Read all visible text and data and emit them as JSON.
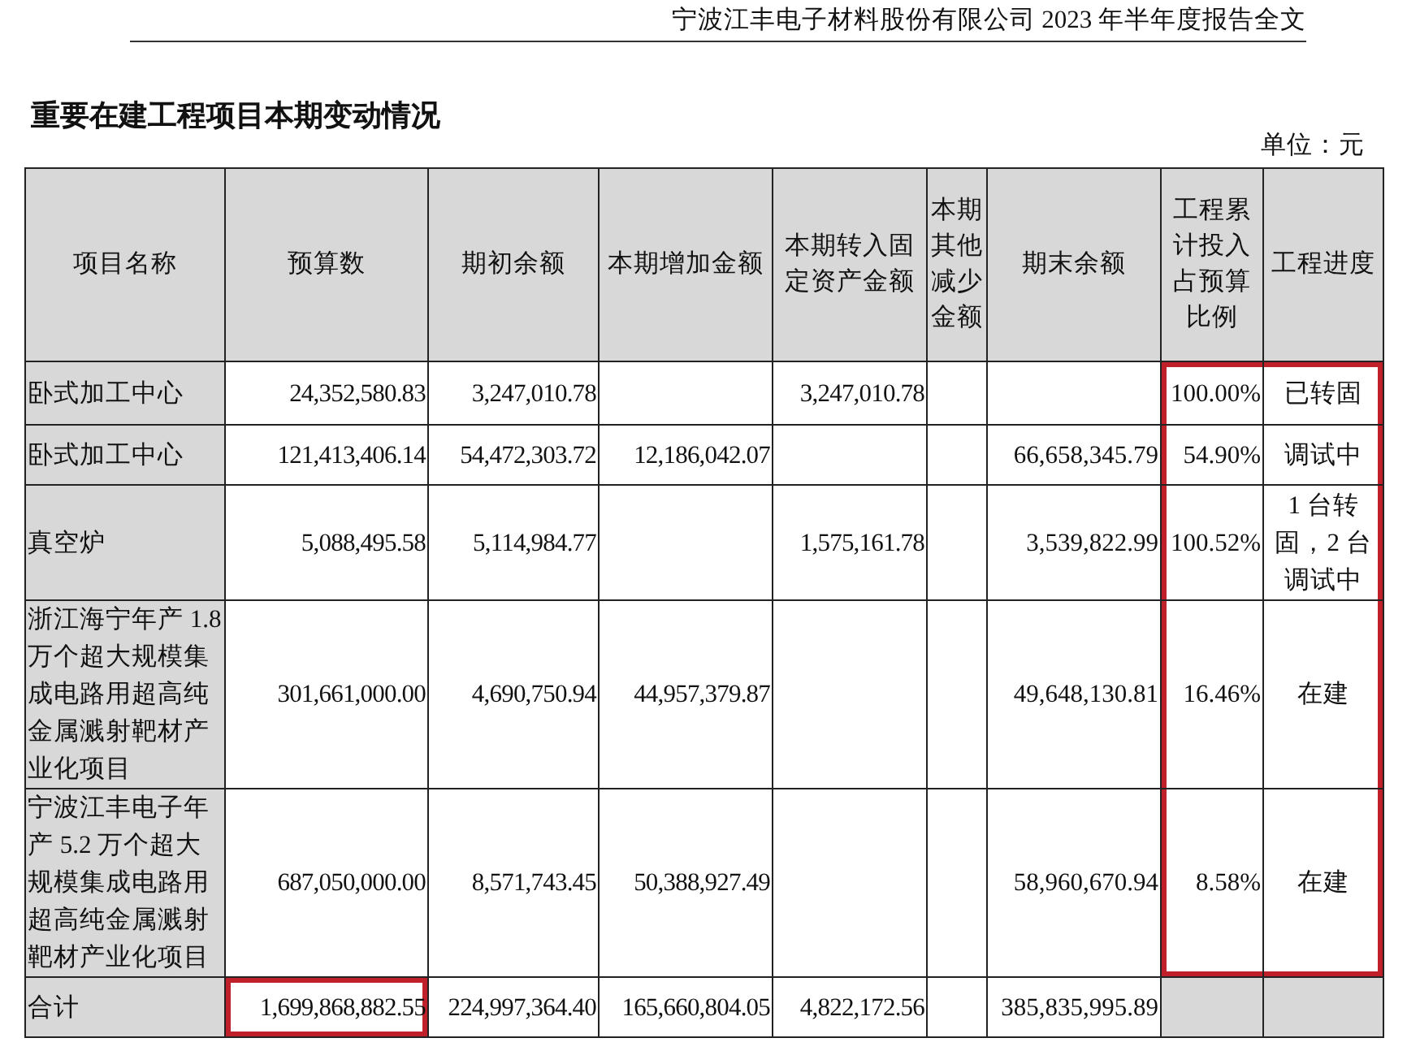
{
  "page_header": "宁波江丰电子材料股份有限公司 2023 年半年度报告全文",
  "title": "重要在建工程项目本期变动情况",
  "unit": "单位：元",
  "table": {
    "columns": [
      "项目名称",
      "预算数",
      "期初余额",
      "本期增加金额",
      "本期转入固定资产金额",
      "本期其他减少金额",
      "期末余额",
      "工程累计投入占预算比例",
      "工程进度"
    ],
    "rows": [
      {
        "name": "卧式加工中心",
        "budget": "24,352,580.83",
        "opening": "3,247,010.78",
        "increase": "",
        "transferred": "3,247,010.78",
        "other_decrease": "",
        "closing": "",
        "ratio": "100.00%",
        "progress": "已转固",
        "highlighted": true,
        "budget_highlighted": false
      },
      {
        "name": "卧式加工中心",
        "budget": "121,413,406.14",
        "opening": "54,472,303.72",
        "increase": "12,186,042.07",
        "transferred": "",
        "other_decrease": "",
        "closing": "66,658,345.79",
        "ratio": "54.90%",
        "progress": "调试中",
        "highlighted": true,
        "budget_highlighted": false
      },
      {
        "name": "真空炉",
        "budget": "5,088,495.58",
        "opening": "5,114,984.77",
        "increase": "",
        "transferred": "1,575,161.78",
        "other_decrease": "",
        "closing": "3,539,822.99",
        "ratio": "100.52%",
        "progress": "1 台转固，2 台调试中",
        "highlighted": true,
        "budget_highlighted": false
      },
      {
        "name": "浙江海宁年产 1.8 万个超大规模集成电路用超高纯金属溅射靶材产业化项目",
        "budget": "301,661,000.00",
        "opening": "4,690,750.94",
        "increase": "44,957,379.87",
        "transferred": "",
        "other_decrease": "",
        "closing": "49,648,130.81",
        "ratio": "16.46%",
        "progress": "在建",
        "highlighted": true,
        "budget_highlighted": false
      },
      {
        "name": "宁波江丰电子年产 5.2 万个超大规模集成电路用超高纯金属溅射靶材产业化项目",
        "budget": "687,050,000.00",
        "opening": "8,571,743.45",
        "increase": "50,388,927.49",
        "transferred": "",
        "other_decrease": "",
        "closing": "58,960,670.94",
        "ratio": "8.58%",
        "progress": "在建",
        "highlighted": true,
        "budget_highlighted": false
      },
      {
        "name": "合计",
        "budget": "1,699,868,882.55",
        "opening": "224,997,364.40",
        "increase": "165,660,804.05",
        "transferred": "4,822,172.56",
        "other_decrease": "",
        "closing": "385,835,995.89",
        "ratio": "",
        "progress": "",
        "highlighted": false,
        "budget_highlighted": true
      }
    ]
  }
}
